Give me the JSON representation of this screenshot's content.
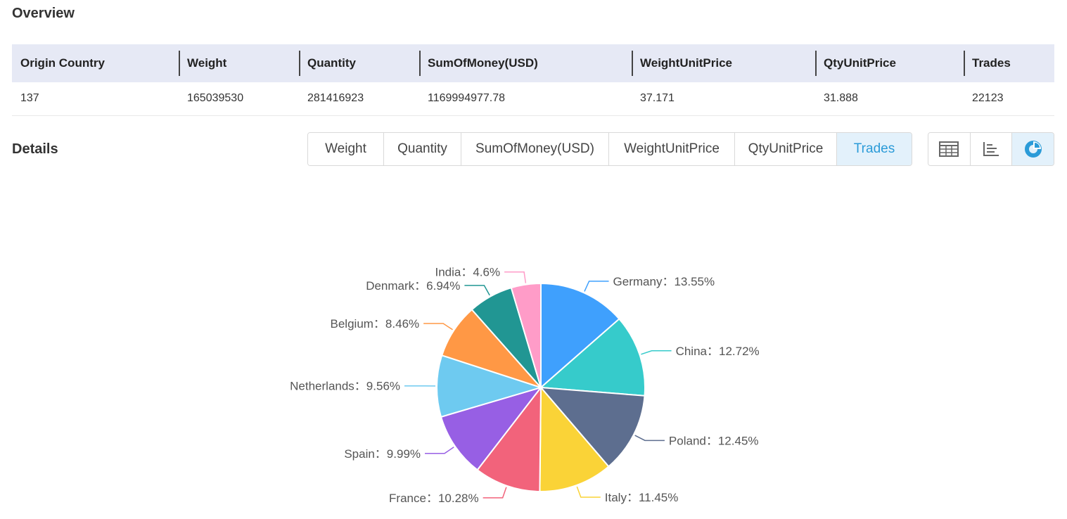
{
  "overview": {
    "title": "Overview",
    "columns": [
      "Origin Country",
      "Weight",
      "Quantity",
      "SumOfMoney(USD)",
      "WeightUnitPrice",
      "QtyUnitPrice",
      "Trades"
    ],
    "row": [
      "137",
      "165039530",
      "281416923",
      "1169994977.78",
      "37.171",
      "31.888",
      "22123"
    ]
  },
  "details": {
    "title": "Details",
    "tabs": [
      {
        "label": "Weight",
        "active": false
      },
      {
        "label": "Quantity",
        "active": false
      },
      {
        "label": "SumOfMoney(USD)",
        "active": false
      },
      {
        "label": "WeightUnitPrice",
        "active": false
      },
      {
        "label": "QtyUnitPrice",
        "active": false
      },
      {
        "label": "Trades",
        "active": true
      }
    ],
    "views": [
      {
        "icon": "table-view-icon",
        "active": false
      },
      {
        "icon": "bar-chart-view-icon",
        "active": false
      },
      {
        "icon": "pie-chart-view-icon",
        "active": true
      }
    ],
    "accent_color": "#2b9bd8"
  },
  "chart_data": {
    "type": "pie",
    "categories": [
      "Germany",
      "China",
      "Poland",
      "Italy",
      "France",
      "Spain",
      "Netherlands",
      "Belgium",
      "Denmark",
      "India"
    ],
    "values": [
      13.55,
      12.72,
      12.45,
      11.45,
      10.28,
      9.99,
      9.56,
      8.46,
      6.94,
      4.6
    ],
    "labels": [
      "Germany：13.55%",
      "China：12.72%",
      "Poland：12.45%",
      "Italy：11.45%",
      "France：10.28%",
      "Spain：9.99%",
      "Netherlands：9.56%",
      "Belgium：8.46%",
      "Denmark：6.94%",
      "India：4.6%"
    ],
    "colors": [
      "#3fa0fd",
      "#36cbcb",
      "#5d6e8f",
      "#fad337",
      "#f2637b",
      "#975fe4",
      "#6ecaf0",
      "#ff9845",
      "#219693",
      "#ff9cc8"
    ]
  }
}
